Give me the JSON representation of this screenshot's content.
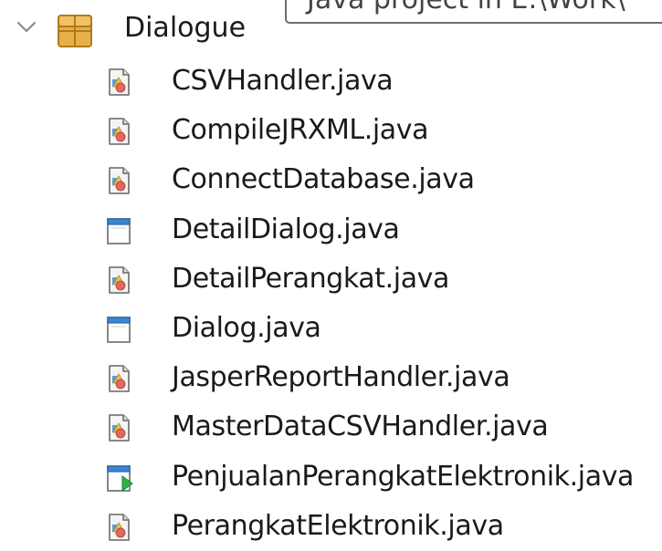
{
  "tooltip": {
    "text": "Java project in E:\\Work\\"
  },
  "package": {
    "label": "Dialogue",
    "icon": "package-icon",
    "expanded": true
  },
  "files": [
    {
      "label": "CSVHandler.java",
      "icon": "java-class-icon"
    },
    {
      "label": "CompileJRXML.java",
      "icon": "java-class-icon"
    },
    {
      "label": "ConnectDatabase.java",
      "icon": "java-class-icon"
    },
    {
      "label": "DetailDialog.java",
      "icon": "java-form-icon"
    },
    {
      "label": "DetailPerangkat.java",
      "icon": "java-class-icon"
    },
    {
      "label": "Dialog.java",
      "icon": "java-form-icon"
    },
    {
      "label": "JasperReportHandler.java",
      "icon": "java-class-icon"
    },
    {
      "label": "MasterDataCSVHandler.java",
      "icon": "java-class-icon"
    },
    {
      "label": "PenjualanPerangkatElektronik.java",
      "icon": "java-main-form-icon"
    },
    {
      "label": "PerangkatElektronik.java",
      "icon": "java-class-icon"
    }
  ],
  "colors": {
    "package_fill": "#e8b04a",
    "package_stroke": "#b07a1c",
    "run_arrow": "#2bb24c",
    "form_header": "#3a86d4"
  }
}
